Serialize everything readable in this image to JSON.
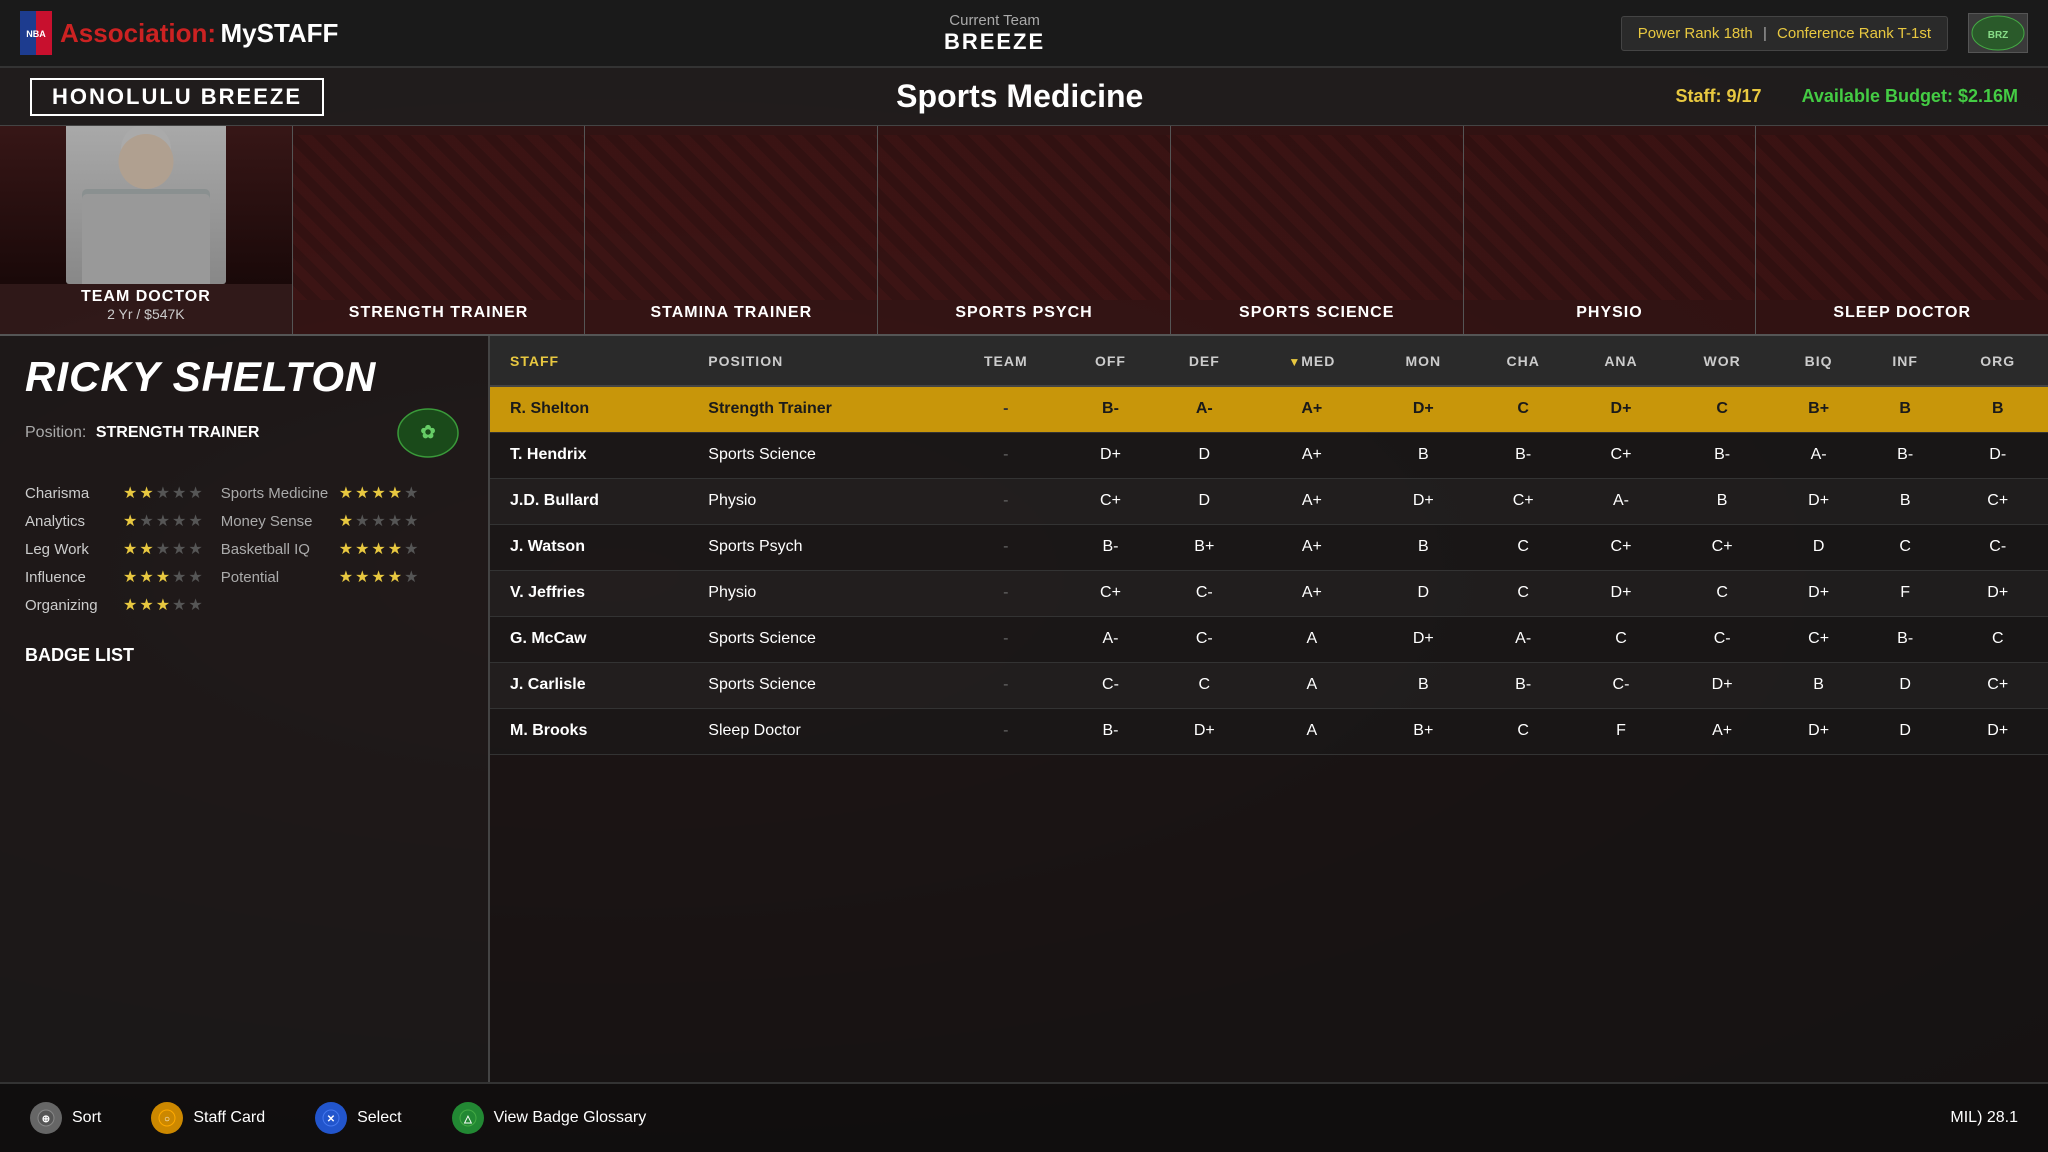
{
  "nav": {
    "logo_text": "byNBA",
    "title_assoc": "Association:",
    "title_mystaff": "MySTAFF",
    "current_team_label": "Current Team",
    "team_name": "BREEZE",
    "power_rank_label": "Power Rank",
    "power_rank_value": "18th",
    "conf_rank_label": "Conference Rank",
    "conf_rank_value": "T-1st"
  },
  "header": {
    "team_full": "HONOLULU BREEZE",
    "section": "Sports Medicine",
    "staff_label": "Staff:",
    "staff_current": "9",
    "staff_max": "17",
    "budget_label": "Available Budget:",
    "budget_value": "$2.16M"
  },
  "staff_slots": [
    {
      "label": "TEAM DOCTOR",
      "sub": "2 Yr / $547K",
      "has_player": true
    },
    {
      "label": "STRENGTH TRAINER",
      "sub": "",
      "has_player": false
    },
    {
      "label": "STAMINA TRAINER",
      "sub": "",
      "has_player": false
    },
    {
      "label": "SPORTS PSYCH",
      "sub": "",
      "has_player": false
    },
    {
      "label": "SPORTS SCIENCE",
      "sub": "",
      "has_player": false
    },
    {
      "label": "PHYSIO",
      "sub": "",
      "has_player": false
    },
    {
      "label": "SLEEP DOCTOR",
      "sub": "",
      "has_player": false
    }
  ],
  "player": {
    "name": "RICKY SHELTON",
    "position_label": "Position:",
    "position": "STRENGTH TRAINER",
    "attributes": [
      {
        "name": "Charisma",
        "stars": 2,
        "right_label": "Sports Medicine",
        "right_stars": 4
      },
      {
        "name": "Analytics",
        "stars": 1,
        "right_label": "Money Sense",
        "right_stars": 1
      },
      {
        "name": "Leg Work",
        "stars": 2,
        "right_label": "Basketball IQ",
        "right_stars": 4
      },
      {
        "name": "Influence",
        "stars": 3,
        "right_label": "Potential",
        "right_stars": 4
      },
      {
        "name": "Organizing",
        "stars": 3,
        "right_label": "",
        "right_stars": 0
      }
    ],
    "badge_list_label": "BADGE LIST"
  },
  "table": {
    "columns": [
      "STAFF",
      "POSITION",
      "TEAM",
      "OFF",
      "DEF",
      "MED",
      "MON",
      "CHA",
      "ANA",
      "WOR",
      "BIQ",
      "INF",
      "ORG"
    ],
    "sort_col": "MED",
    "rows": [
      {
        "name": "R. Shelton",
        "position": "Strength Trainer",
        "team": "-",
        "off": "B-",
        "def": "A-",
        "med": "A+",
        "mon": "D+",
        "cha": "C",
        "ana": "D+",
        "wor": "C",
        "biq": "B+",
        "inf": "B",
        "org": "B",
        "highlight": true
      },
      {
        "name": "T. Hendrix",
        "position": "Sports Science",
        "team": "-",
        "off": "D+",
        "def": "D",
        "med": "A+",
        "mon": "B",
        "cha": "B-",
        "ana": "C+",
        "wor": "B-",
        "biq": "A-",
        "inf": "B-",
        "org": "D-",
        "highlight": false
      },
      {
        "name": "J.D. Bullard",
        "position": "Physio",
        "team": "-",
        "off": "C+",
        "def": "D",
        "med": "A+",
        "mon": "D+",
        "cha": "C+",
        "ana": "A-",
        "wor": "B",
        "biq": "D+",
        "inf": "B",
        "org": "C+",
        "highlight": false
      },
      {
        "name": "J. Watson",
        "position": "Sports Psych",
        "team": "-",
        "off": "B-",
        "def": "B+",
        "med": "A+",
        "mon": "B",
        "cha": "C",
        "ana": "C+",
        "wor": "C+",
        "biq": "D",
        "inf": "C",
        "org": "C-",
        "highlight": false
      },
      {
        "name": "V. Jeffries",
        "position": "Physio",
        "team": "-",
        "off": "C+",
        "def": "C-",
        "med": "A+",
        "mon": "D",
        "cha": "C",
        "ana": "D+",
        "wor": "C",
        "biq": "D+",
        "inf": "F",
        "org": "D+",
        "highlight": false
      },
      {
        "name": "G. McCaw",
        "position": "Sports Science",
        "team": "-",
        "off": "A-",
        "def": "C-",
        "med": "A",
        "mon": "D+",
        "cha": "A-",
        "ana": "C",
        "wor": "C-",
        "biq": "C+",
        "inf": "B-",
        "org": "C",
        "highlight": false
      },
      {
        "name": "J. Carlisle",
        "position": "Sports Science",
        "team": "-",
        "off": "C-",
        "def": "C",
        "med": "A",
        "mon": "B",
        "cha": "B-",
        "ana": "C-",
        "wor": "D+",
        "biq": "B",
        "inf": "D",
        "org": "C+",
        "highlight": false
      },
      {
        "name": "M. Brooks",
        "position": "Sleep Doctor",
        "team": "-",
        "off": "B-",
        "def": "D+",
        "med": "A",
        "mon": "B+",
        "cha": "C",
        "ana": "F",
        "wor": "A+",
        "biq": "D+",
        "inf": "D",
        "org": "D+",
        "highlight": false
      }
    ]
  },
  "bottom_bar": {
    "sort_label": "Sort",
    "staff_card_label": "Staff Card",
    "select_label": "Select",
    "view_badge_label": "View Badge Glossary",
    "status": "MIL) 28.1"
  }
}
